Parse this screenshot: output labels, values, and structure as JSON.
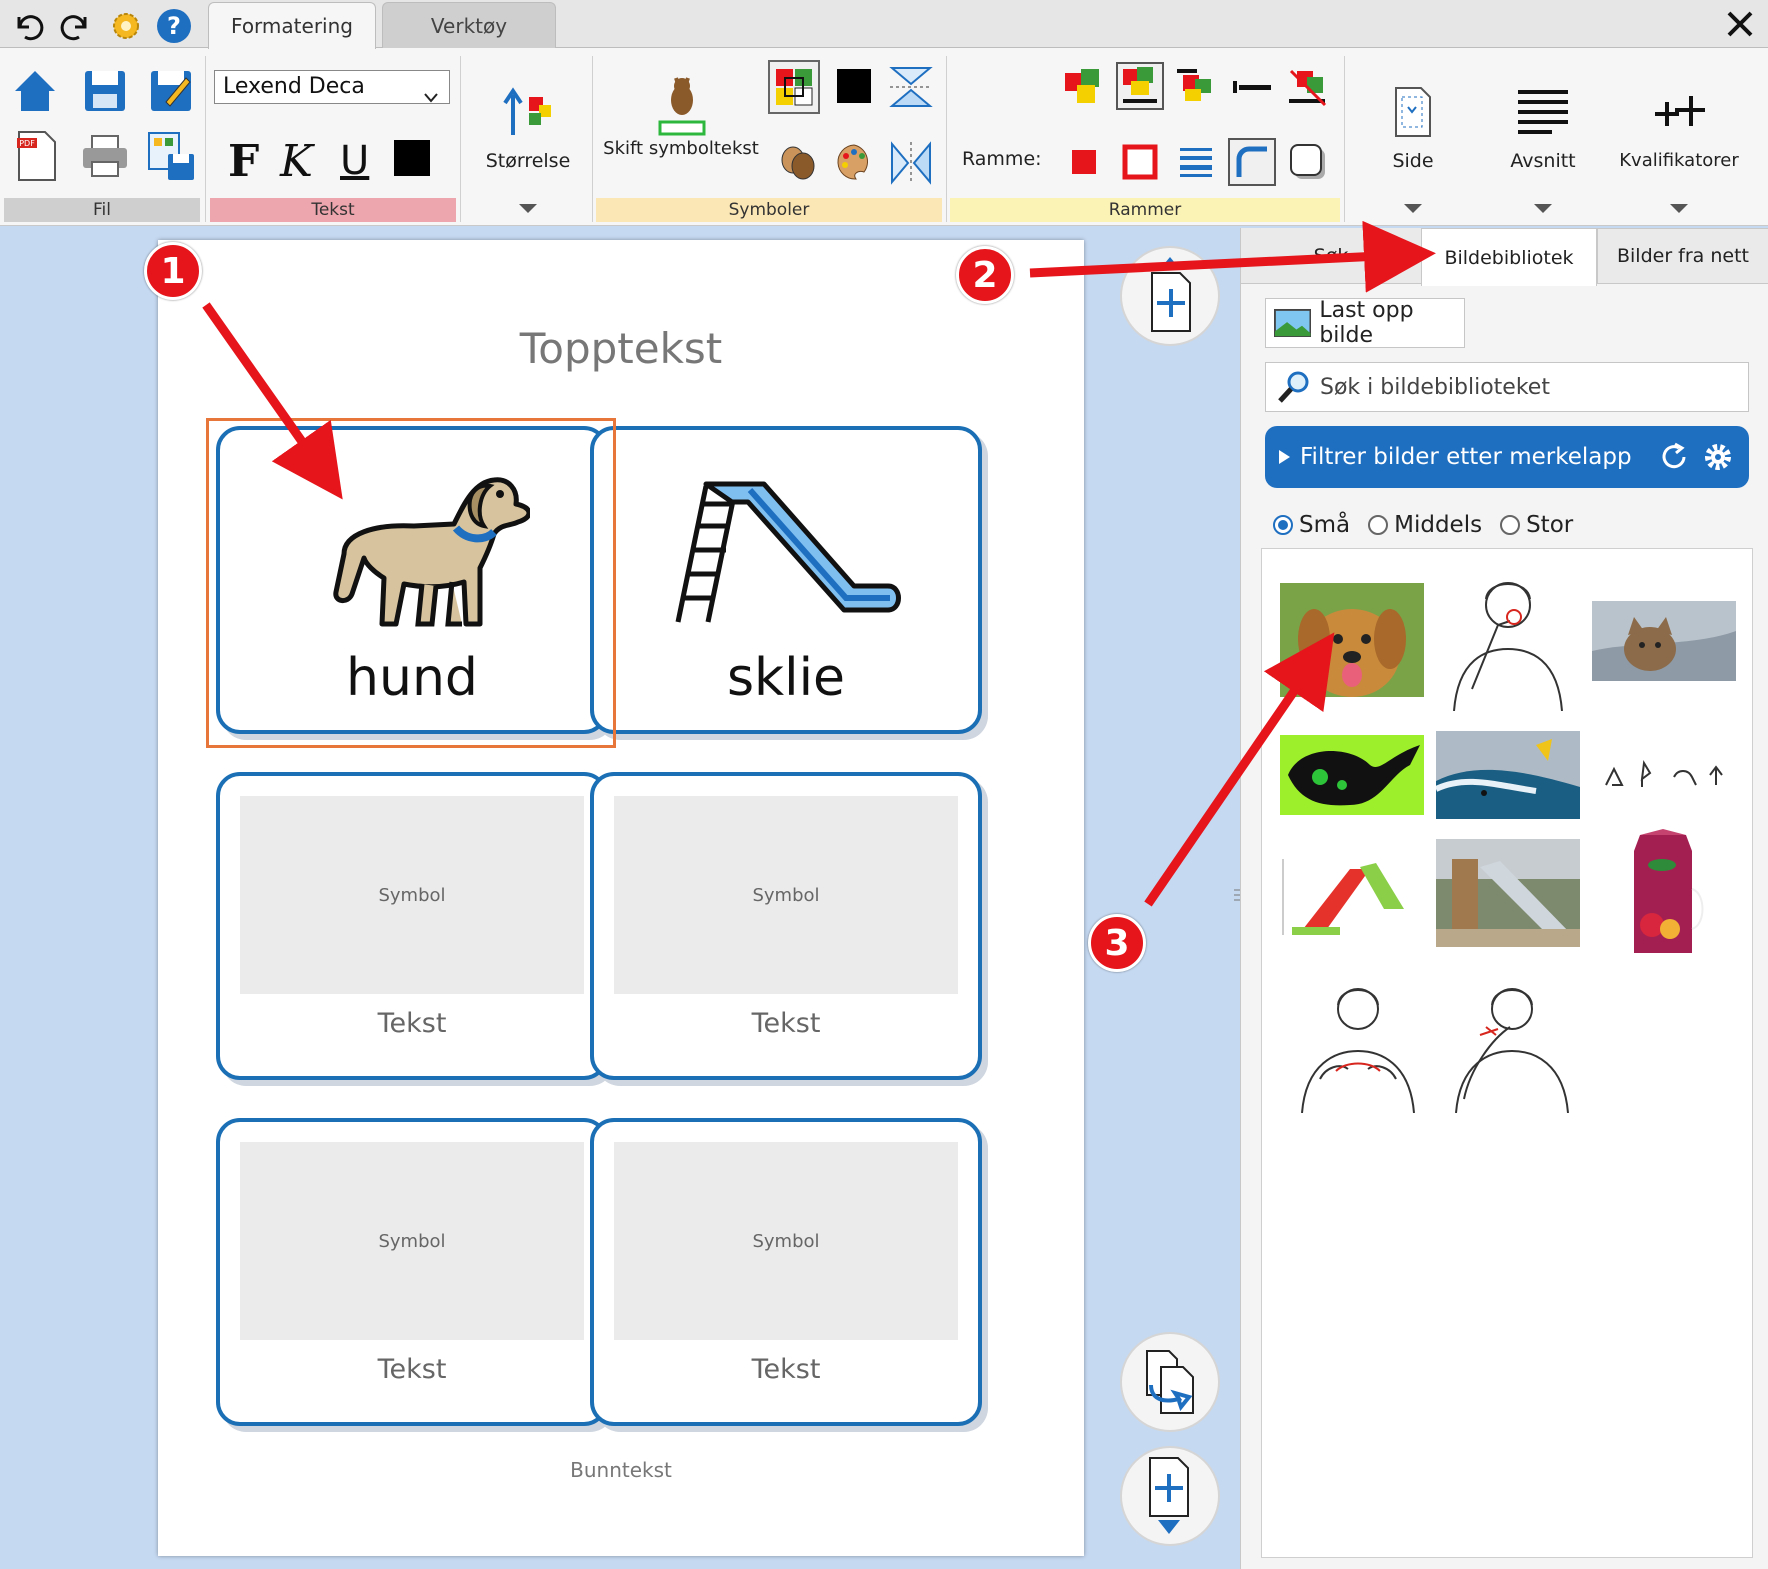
{
  "ribbon": {
    "tabs": [
      {
        "label": "Formatering"
      },
      {
        "label": "Verktøy"
      }
    ],
    "groups": {
      "fil": {
        "label": "Fil"
      },
      "tekst": {
        "label": "Tekst",
        "font_value": "Lexend Deca",
        "bold": "F",
        "italic": "K",
        "underline": "U"
      },
      "storrelse": {
        "label": "Størrelse"
      },
      "symboler": {
        "label": "Symboler",
        "switch_text": "Skift symboltekst"
      },
      "rammer": {
        "label": "Rammer",
        "frame_label": "Ramme:"
      },
      "side": {
        "label": "Side"
      },
      "avsnitt": {
        "label": "Avsnitt"
      },
      "kvalifikatorer": {
        "label": "Kvalifikatorer"
      }
    },
    "colors": {
      "fil_band": "#cfcfcf",
      "tekst_band": "#eda5ae",
      "symboler_band": "#fbe7b5",
      "rammer_band": "#fbf2b5"
    }
  },
  "document": {
    "header": "Topptekst",
    "footer": "Bunntekst",
    "cells": [
      {
        "word": "hund",
        "icon": "dog-icon"
      },
      {
        "word": "sklie",
        "icon": "slide-icon"
      },
      {
        "placeholder": "Symbol",
        "text": "Tekst"
      },
      {
        "placeholder": "Symbol",
        "text": "Tekst"
      },
      {
        "placeholder": "Symbol",
        "text": "Tekst"
      },
      {
        "placeholder": "Symbol",
        "text": "Tekst"
      }
    ]
  },
  "pane": {
    "tabs": [
      {
        "label": "Søk"
      },
      {
        "label": "Bildebibliotek"
      },
      {
        "label": "Bilder fra nett"
      }
    ],
    "upload_label": "Last opp bilde",
    "search_placeholder": "Søk i bildebiblioteket",
    "filter_label": "Filtrer bilder etter merkelapp",
    "sizes": [
      {
        "label": "Små",
        "selected": true
      },
      {
        "label": "Middels",
        "selected": false
      },
      {
        "label": "Stor",
        "selected": false
      }
    ],
    "thumbnails": [
      {
        "name": "golden-retriever-photo"
      },
      {
        "name": "sign-language-woman-1"
      },
      {
        "name": "cat-photo"
      },
      {
        "name": "green-black-drawing"
      },
      {
        "name": "surfer-wave-photo"
      },
      {
        "name": "sign-writing-symbols"
      },
      {
        "name": "toy-slide-photo"
      },
      {
        "name": "playground-slide-photo"
      },
      {
        "name": "juice-carton-photo"
      },
      {
        "name": "sign-language-woman-2"
      },
      {
        "name": "sign-language-woman-3"
      }
    ]
  },
  "annotations": {
    "badges": [
      "1",
      "2",
      "3"
    ],
    "accent": "#e5151b"
  }
}
